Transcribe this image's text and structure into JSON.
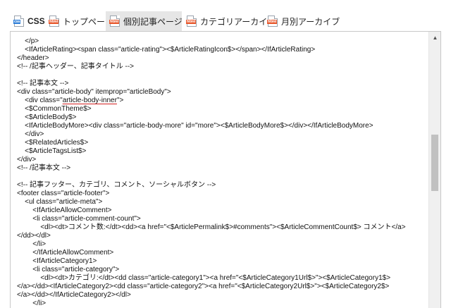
{
  "tabs": [
    {
      "label": "CSS",
      "icon": "css-file-icon",
      "icon_tag": "css",
      "active": false
    },
    {
      "label": "トップページ",
      "icon": "html-file-icon",
      "icon_tag": "html",
      "active": false
    },
    {
      "label": "個別記事ページ",
      "icon": "html-file-icon",
      "icon_tag": "html",
      "active": true
    },
    {
      "label": "カテゴリアーカイブ",
      "icon": "html-file-icon",
      "icon_tag": "html",
      "active": false
    },
    {
      "label": "月別アーカイブ",
      "icon": "html-file-icon",
      "icon_tag": "html",
      "active": false
    }
  ],
  "editor": {
    "lines": [
      "    </p>",
      "    <IfArticleRating><span class=\"article-rating\"><$ArticleRatingIcon$></span></IfArticleRating>",
      "</header>",
      "<!-- /記事ヘッダー、記事タイトル -->",
      "",
      "<!-- 記事本文 -->",
      "<div class=\"article-body\" itemprop=\"articleBody\">",
      "    <div class=\"",
      "    <$CommonTheme$>",
      "    <$ArticleBody$>",
      "    <IfArticleBodyMore><div class=\"article-body-more\" id=\"more\"><$ArticleBodyMore$></div></IfArticleBodyMore>",
      "    </div>",
      "    <$RelatedArticles$>",
      "    <$ArticleTagsList$>",
      "</div>",
      "<!-- /記事本文 -->",
      "",
      "<!-- 記事フッター、カテゴリ、コメント、ソーシャルボタン -->",
      "<footer class=\"article-footer\">",
      "    <ul class=\"article-meta\">",
      "        <IfArticleAllowComment>",
      "        <li class=\"article-comment-count\">",
      "            <dl><dt>コメント数:</dt><dd><a href=\"<$ArticlePermalink$>#comments\"><$ArticleCommentCount$> コメント</a>",
      "</dd></dl>",
      "        </li>",
      "        </IfArticleAllowComment>",
      "        <IfArticleCategory1>",
      "        <li class=\"article-category\">",
      "            <dl><dt>カテゴリ:</dt><dd class=\"article-category1\"><a href=\"<$ArticleCategory1Url$>\"><$ArticleCategory1$>",
      "</a></dd><IfArticleCategory2><dd class=\"article-category2\"><a href=\"<$ArticleCategory2Url$>\"><$ArticleCategory2$>",
      "</a></dd></IfArticleCategory2></dl>",
      "        </li>"
    ],
    "line8_highlight": "article-body-inner",
    "line8_tail": "\">"
  },
  "scrollbar": {
    "up_glyph": "▲"
  }
}
